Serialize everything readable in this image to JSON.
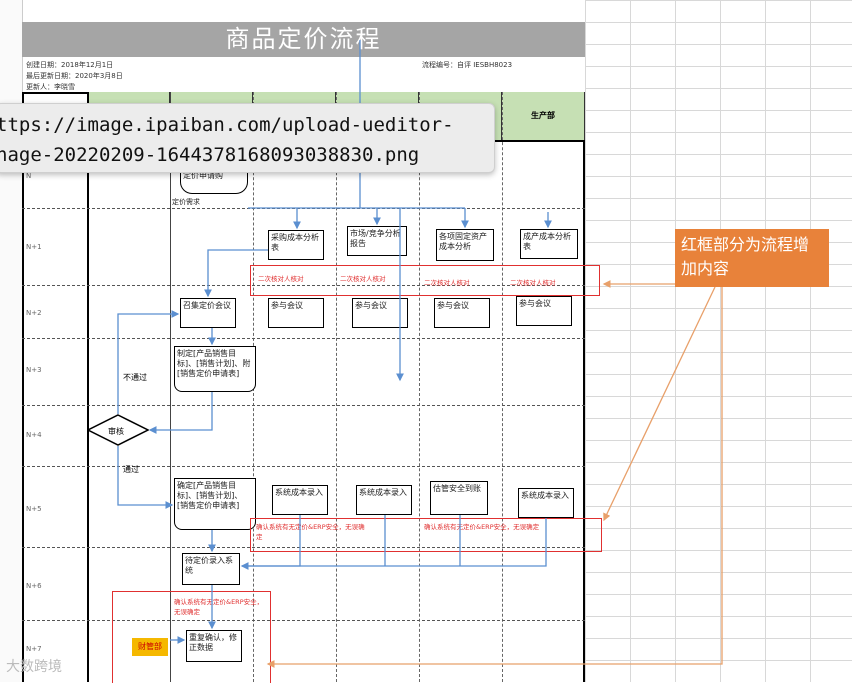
{
  "doc": {
    "title": "商品定价流程",
    "meta_left": [
      "创建日期：2018年12月1日",
      "最后更新日期：2020年3月8日",
      "更新人：李晓雪"
    ],
    "meta_right": "流程编号：自评 IESBH8023"
  },
  "header": {
    "last_col": "生产部"
  },
  "rows": [
    "N",
    "N+1",
    "N+2",
    "N+3",
    "N+4",
    "N+5",
    "N+6",
    "N+7"
  ],
  "boxes": {
    "start": "定价申请购",
    "start_sub": "定价需求",
    "b1": "采购成本分析表",
    "b2": "市场/竞争分析报告",
    "b3": "各项固定资产成本分析",
    "b4": "成产成本分析表",
    "b5": "召集定价会议",
    "b6": "参与会议",
    "b7": "参与会议",
    "b8": "参与会议",
    "b9": "参与会议",
    "b10": "制定[产品销售目标]、[销售计划]、附[销售定价申请表]",
    "decision": "审核",
    "b11": "确定[产品销售目标]、[销售计划]、[销售定价申请表]",
    "b12": "系统成本录入",
    "b13": "系统成本录入",
    "b14": "估管安全到账",
    "b15": "系统成本录入",
    "b16": "待定价录入系统",
    "b17": "重复确认，修正数据"
  },
  "labels": {
    "reject": "不通过",
    "pass": "通过",
    "check": "二次核对人核对",
    "confirm": "确认系统有无定价&ERP安全，无误确定",
    "confirm2": "确认系统有无定价&ERP安全，无误确定",
    "orange_tag": "财管部"
  },
  "tooltip": {
    "line1": "ttps://image.ipaiban.com/upload-ueditor-",
    "line2": "nage-20220209-1644378168093038830.png"
  },
  "annotation": "红框部分为流程增加内容",
  "watermark": "大数跨境",
  "colors": {
    "title_bg": "#a5a5a5",
    "header_green": "#c6e0b4",
    "red": "#e03030",
    "orange": "#e8823a",
    "blue_arrow": "#5b8fd0"
  }
}
